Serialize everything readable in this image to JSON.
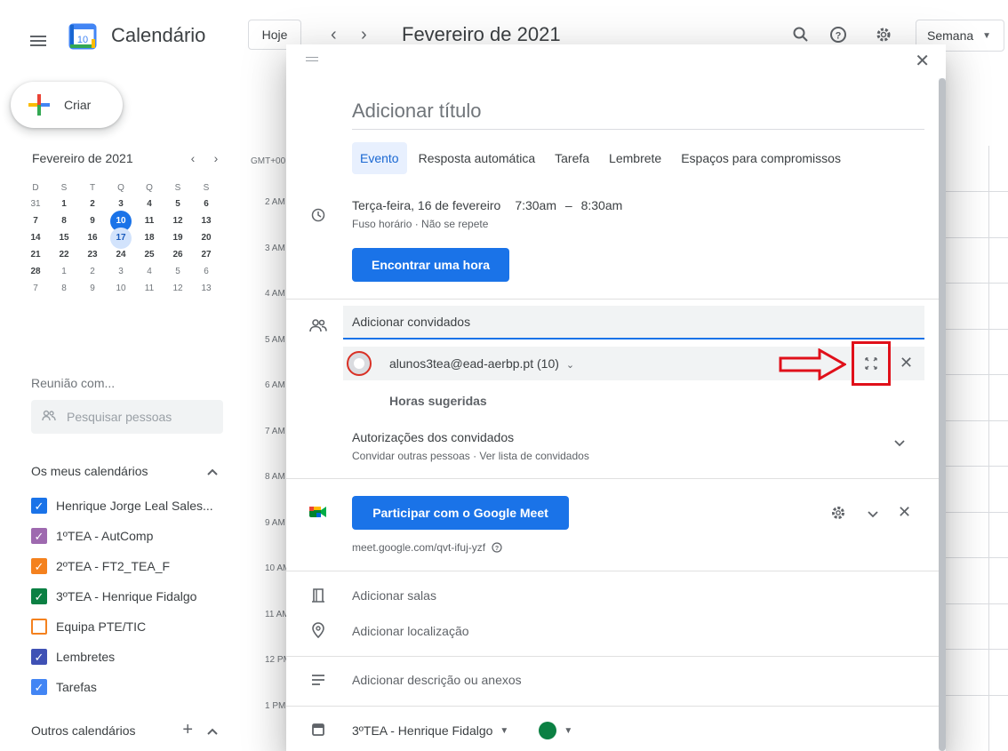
{
  "topbar": {
    "app_title": "Calendário",
    "logo_day": "10",
    "today_label": "Hoje",
    "prev": "‹",
    "next": "›",
    "month_title": "Fevereiro de 2021",
    "view_label": "Semana"
  },
  "sidebar": {
    "create_label": "Criar",
    "mini_cal": {
      "title": "Fevereiro de 2021",
      "prev": "‹",
      "next": "›",
      "dow": [
        "D",
        "S",
        "T",
        "Q",
        "Q",
        "S",
        "S"
      ],
      "rows": [
        [
          "31",
          "1",
          "2",
          "3",
          "4",
          "5",
          "6"
        ],
        [
          "7",
          "8",
          "9",
          "10",
          "11",
          "12",
          "13"
        ],
        [
          "14",
          "15",
          "16",
          "17",
          "18",
          "19",
          "20"
        ],
        [
          "21",
          "22",
          "23",
          "24",
          "25",
          "26",
          "27"
        ],
        [
          "28",
          "1",
          "2",
          "3",
          "4",
          "5",
          "6"
        ],
        [
          "7",
          "8",
          "9",
          "10",
          "11",
          "12",
          "13"
        ]
      ],
      "today": "10",
      "selected": "17"
    },
    "meet_title": "Reunião com...",
    "search_people_placeholder": "Pesquisar pessoas",
    "my_calendars_title": "Os meus calendários",
    "my_calendars": [
      {
        "label": "Henrique Jorge Leal Sales...",
        "color": "#1a73e8",
        "checked": true
      },
      {
        "label": "1ºTEA - AutComp",
        "color": "#9e69af",
        "checked": true
      },
      {
        "label": "2ºTEA - FT2_TEA_F",
        "color": "#f4811e",
        "checked": true
      },
      {
        "label": "3ºTEA - Henrique Fidalgo",
        "color": "#0b8043",
        "checked": true
      },
      {
        "label": "Equipa PTE/TIC",
        "color": "#f4811e",
        "checked": false
      },
      {
        "label": "Lembretes",
        "color": "#3f51b5",
        "checked": true
      },
      {
        "label": "Tarefas",
        "color": "#4285f4",
        "checked": true
      }
    ],
    "other_calendars_title": "Outros calendários"
  },
  "grid": {
    "tz": "GMT+00",
    "hours": [
      "2 AM",
      "3 AM",
      "4 AM",
      "5 AM",
      "6 AM",
      "7 AM",
      "8 AM",
      "9 AM",
      "10 AM",
      "11 AM",
      "12 PM",
      "1 PM"
    ]
  },
  "dialog": {
    "title_placeholder": "Adicionar título",
    "tabs": [
      "Evento",
      "Resposta automática",
      "Tarefa",
      "Lembrete",
      "Espaços para compromissos"
    ],
    "active_tab": "Evento",
    "date": "Terça-feira, 16 de fevereiro",
    "time_start": "7:30am",
    "time_sep": "–",
    "time_end": "8:30am",
    "date_sub": "Fuso horário · Não se repete",
    "find_time_label": "Encontrar uma hora",
    "guests_placeholder": "Adicionar convidados",
    "guest_name": "alunos3tea@ead-aerbp.pt (10)",
    "suggested_hours": "Horas sugeridas",
    "permissions_title": "Autorizações dos convidados",
    "permissions_sub": "Convidar outras pessoas · Ver lista de convidados",
    "meet_button": "Participar com o Google Meet",
    "meet_link": "meet.google.com/qvt-ifuj-yzf",
    "add_rooms": "Adicionar salas",
    "add_location": "Adicionar localização",
    "add_description": "Adicionar descrição ou anexos",
    "calendar_name": "3ºTEA - Henrique Fidalgo",
    "calendar_color": "#0b8043"
  },
  "colors": {
    "accent": "#1a73e8",
    "annotation": "#e0101a"
  }
}
